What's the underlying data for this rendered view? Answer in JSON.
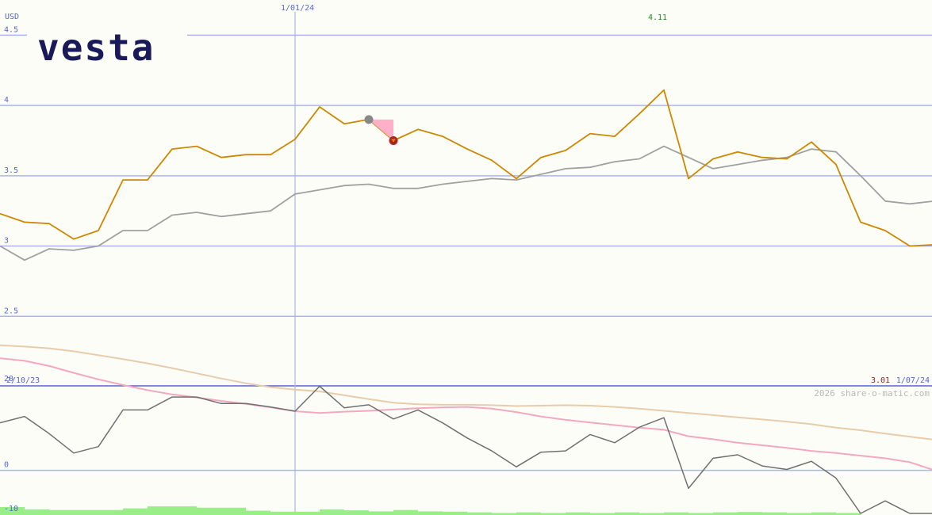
{
  "brand": {
    "logo_text": "vesta"
  },
  "labels": {
    "currency": "USD",
    "date_marker": "1/01/24",
    "start_date": "2/10/23",
    "end_date": "1/07/24",
    "max_label": "4.11",
    "last_label": "3.01",
    "copyright": "2026 share-o-matic.com"
  },
  "colors": {
    "background": "#fdfdf8",
    "grid": "#aab4ee",
    "axis_text": "#5566cc",
    "price": "#cc8800",
    "price_avg": "#a0a0a0",
    "osc": "#707070",
    "osc_fast": "#f4a8c0",
    "osc_slow": "#e8ccaa",
    "volume": "#99ee88",
    "marker_start": "#888888",
    "marker_end": "#aa2222",
    "marker_fill": "#ffb0c8",
    "max_label": "#228822",
    "last_label": "#882222",
    "logo": "#1a1a5a"
  },
  "chart_data": [
    {
      "type": "line",
      "name": "price-panel",
      "ylim": [
        2.0,
        4.75
      ],
      "yticks": [
        2.5,
        3,
        3.5,
        4,
        4.5
      ],
      "ytick_labels": [
        "2.5",
        "3",
        "3.5",
        "4",
        "4.5"
      ],
      "series": [
        {
          "key": "price",
          "values": [
            3.23,
            3.17,
            3.16,
            3.05,
            3.11,
            3.47,
            3.47,
            3.69,
            3.71,
            3.63,
            3.65,
            3.65,
            3.76,
            3.99,
            3.87,
            3.9,
            3.75,
            3.83,
            3.78,
            3.69,
            3.61,
            3.48,
            3.63,
            3.68,
            3.8,
            3.78,
            3.94,
            4.11,
            3.48,
            3.62,
            3.67,
            3.63,
            3.62,
            3.74,
            3.58,
            3.17,
            3.11,
            3.0,
            3.01
          ]
        },
        {
          "key": "price_avg",
          "values": [
            3.0,
            2.9,
            2.98,
            2.97,
            3.0,
            3.11,
            3.11,
            3.22,
            3.24,
            3.21,
            3.23,
            3.25,
            3.37,
            3.4,
            3.43,
            3.44,
            3.41,
            3.41,
            3.44,
            3.46,
            3.48,
            3.47,
            3.51,
            3.55,
            3.56,
            3.6,
            3.62,
            3.71,
            3.63,
            3.55,
            3.58,
            3.61,
            3.63,
            3.69,
            3.67,
            3.5,
            3.32,
            3.3,
            3.32
          ]
        }
      ],
      "markers": {
        "start_value": 3.9,
        "end_value": 3.75
      }
    },
    {
      "type": "line",
      "name": "oscillator-panel",
      "ylim": [
        -10,
        24
      ],
      "yticks": [
        -10,
        0,
        20
      ],
      "ytick_labels": [
        "-10",
        "0",
        "20"
      ],
      "series": [
        {
          "key": "osc",
          "values": [
            11,
            12.5,
            8.5,
            4,
            5.5,
            14,
            14,
            17,
            17,
            15.5,
            15.5,
            14.7,
            13.7,
            19.5,
            14.5,
            15.2,
            11.9,
            14,
            11,
            7.5,
            4.5,
            0.8,
            4.2,
            4.5,
            8.3,
            6.4,
            10,
            12.2,
            -4.2,
            2.8,
            3.6,
            1,
            0.2,
            2.1,
            -1.8,
            -10,
            -7.1,
            -10,
            -10
          ]
        },
        {
          "key": "osc_fast",
          "values": [
            26,
            25.4,
            24.2,
            22.6,
            21.1,
            19.8,
            18.6,
            17.6,
            16.9,
            16.1,
            15.4,
            14.6,
            13.7,
            13.3,
            13.6,
            13.8,
            14.1,
            14.4,
            14.6,
            14.7,
            14.3,
            13.5,
            12.5,
            11.7,
            11.1,
            10.5,
            9.9,
            9.4,
            7.9,
            7.2,
            6.4,
            5.8,
            5.2,
            4.5,
            4,
            3.4,
            2.8,
            1.9,
            0
          ]
        },
        {
          "key": "osc_slow",
          "values": [
            29,
            28.7,
            28.3,
            27.6,
            26.7,
            25.8,
            24.8,
            23.7,
            22.5,
            21.3,
            20.2,
            19.3,
            18.7,
            18.3,
            17.4,
            16.5,
            15.7,
            15.3,
            15.2,
            15.2,
            15.1,
            14.9,
            15,
            15.1,
            15,
            14.7,
            14.3,
            13.8,
            13.3,
            12.8,
            12.3,
            11.8,
            11.3,
            10.7,
            9.9,
            9.3,
            8.5,
            7.8,
            7.1
          ]
        }
      ],
      "volume": [
        2.4,
        1.7,
        1.5,
        1.5,
        1.5,
        2.0,
        2.6,
        2.6,
        2.2,
        2.2,
        1.3,
        1.0,
        1.0,
        1.7,
        1.4,
        1.1,
        1.5,
        1.1,
        1.0,
        0.8,
        0.6,
        0.8,
        0.6,
        0.8,
        0.6,
        0.8,
        0.6,
        0.8,
        0.6,
        0.8,
        0.9,
        0.8,
        0.6,
        0.8,
        0.6
      ]
    }
  ]
}
